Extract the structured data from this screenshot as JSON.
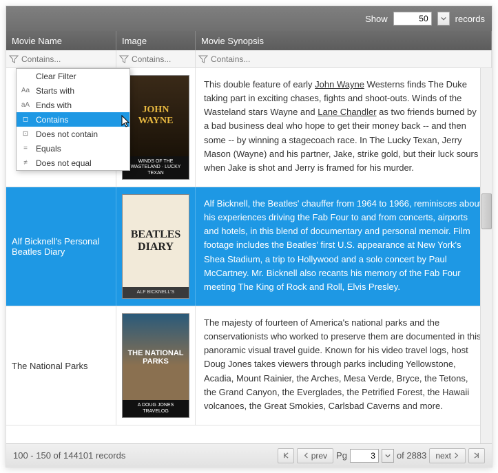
{
  "topbar": {
    "show": "Show",
    "value": "50",
    "records": "records"
  },
  "cols": {
    "name": "Movie Name",
    "image": "Image",
    "syn": "Movie Synopsis"
  },
  "filter_ph": "Contains...",
  "menu": {
    "items": [
      {
        "icon": "",
        "label": "Clear Filter"
      },
      {
        "icon": "Aa",
        "label": "Starts with"
      },
      {
        "icon": "aA",
        "label": "Ends with"
      },
      {
        "icon": "◻",
        "label": "Contains",
        "sel": true
      },
      {
        "icon": "⊡",
        "label": "Does not contain"
      },
      {
        "icon": "=",
        "label": "Equals"
      },
      {
        "icon": "≠",
        "label": "Does not equal"
      }
    ]
  },
  "rows": [
    {
      "name": "",
      "poster": {
        "cls": "p0",
        "t1": "JOHN WAYNE",
        "t2": "WINDS OF THE WASTELAND · LUCKY TEXAN"
      },
      "syn": "This double feature of early <span class='lk'>John Wayne</span> Westerns finds The Duke taking part in exciting chases, fights and shoot-outs. Winds of the Wasteland stars Wayne and <span class='lk'>Lane Chandler</span> as two friends burned by a bad business deal who hope to get their money back -- and then some -- by winning a stagecoach race. In The Lucky Texan, Jerry Mason (Wayne) and his partner, Jake, strike gold, but their luck sours when Jake is shot and Jerry is framed for his murder."
    },
    {
      "name": "Alf Bicknell's Personal Beatles Diary",
      "sel": true,
      "poster": {
        "cls": "p1",
        "t1": "BEATLES DIARY",
        "t2": "ALF BICKNELL'S"
      },
      "syn": "Alf Bicknell, the Beatles' chauffer from 1964 to 1966, reminisces about his experiences driving the Fab Four to and from concerts, airports and hotels, in this blend of documentary and personal memoir. Film footage includes the Beatles' first U.S. appearance at New York's Shea Stadium, a trip to Hollywood and a solo concert by Paul McCartney. Mr. Bicknell also recants his memory of the Fab Four meeting The King of Rock and Roll, Elvis Presley."
    },
    {
      "name": "The National Parks",
      "poster": {
        "cls": "p2",
        "t1": "THE NATIONAL PARKS",
        "t2": "A DOUG JONES TRAVELOG"
      },
      "syn": "The majesty of fourteen of America's national parks and the conservationists who worked to preserve them are documented in this panoramic visual travel guide. Known for his video travel logs, host Doug Jones takes viewers through parks including Yellowstone, Acadia, Mount Rainier, the Arches, Mesa Verde, Bryce, the Tetons, the Grand Canyon, the Everglades, the Petrified Forest, the Hawaii volcanoes, the Great Smokies, Carlsbad Caverns and more."
    }
  ],
  "footer": {
    "status": "100 - 150 of 144101 records",
    "prev": "prev",
    "pg": "Pg",
    "page": "3",
    "of": "of 2883",
    "next": "next"
  }
}
